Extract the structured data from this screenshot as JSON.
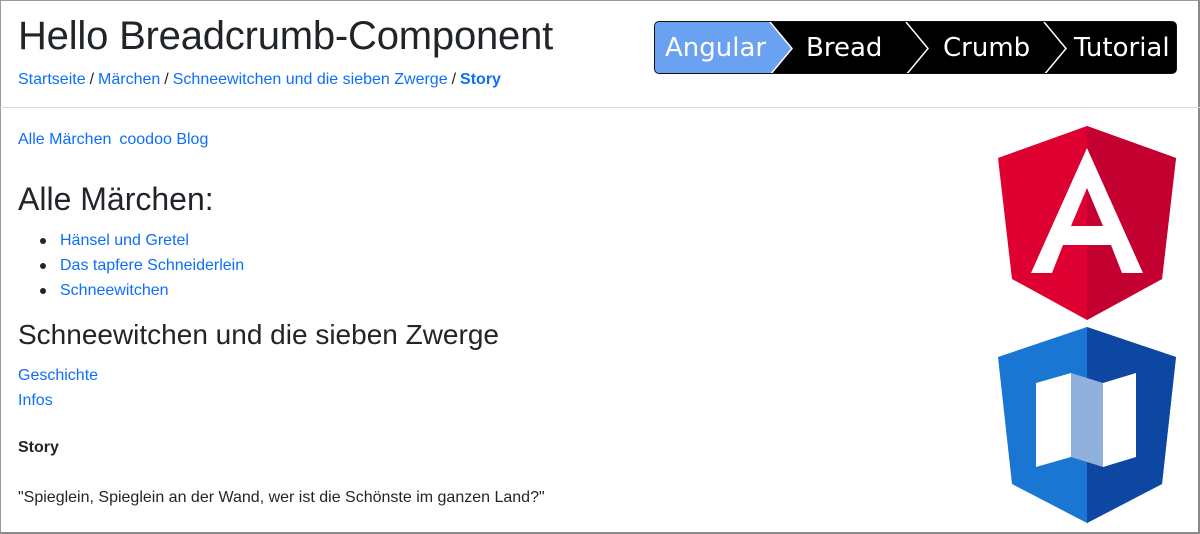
{
  "header": {
    "title": "Hello Breadcrumb-Component"
  },
  "breadcrumb": {
    "items": [
      {
        "label": "Startseite"
      },
      {
        "label": "Märchen"
      },
      {
        "label": "Schneewitchen und die sieben Zwerge"
      },
      {
        "label": "Story"
      }
    ],
    "separator": "/"
  },
  "crumb_banner": {
    "items": [
      {
        "label": "Angular"
      },
      {
        "label": "Bread"
      },
      {
        "label": "Crumb"
      },
      {
        "label": "Tutorial"
      }
    ],
    "colors": {
      "active": "#6aa1f0",
      "inactive": "#000000",
      "text": "#ffffff"
    }
  },
  "top_nav": {
    "all_tales": "Alle Märchen",
    "blog": "coodoo Blog"
  },
  "main": {
    "all_tales_heading": "Alle Märchen:",
    "tales": [
      {
        "label": "Hänsel und Gretel"
      },
      {
        "label": "Das tapfere Schneiderlein"
      },
      {
        "label": "Schneewitchen"
      }
    ],
    "tale_heading": "Schneewitchen und die sieben Zwerge",
    "tale_links": [
      {
        "label": "Geschichte"
      },
      {
        "label": "Infos"
      }
    ],
    "story_label": "Story",
    "story_text": "\"Spieglein, Spieglein an der Wand, wer ist die Schönste im ganzen Land?\""
  },
  "logos": {
    "angular": {
      "icon": "angular-logo-icon",
      "colors": [
        "#dd0031",
        "#c3002f",
        "#ffffff"
      ]
    },
    "map": {
      "icon": "map-logo-icon",
      "colors": [
        "#1976d2",
        "#0d47a1",
        "#ffffff",
        "#8fb1dc"
      ]
    }
  },
  "colors": {
    "link": "#0d6efd",
    "text": "#212529"
  }
}
